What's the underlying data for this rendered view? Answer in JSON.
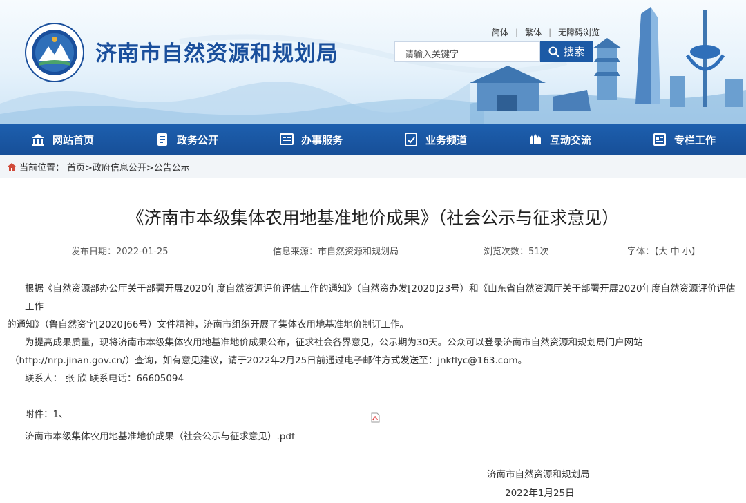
{
  "header": {
    "site_title": "济南市自然资源和规划局",
    "top_links": [
      "简体",
      "繁体",
      "无障碍浏览"
    ],
    "search": {
      "placeholder": "请输入关键字",
      "button_label": "搜索"
    },
    "accent": "#1c5aa6"
  },
  "nav": {
    "items": [
      {
        "label": "网站首页",
        "icon": "home-icon"
      },
      {
        "label": "政务公开",
        "icon": "document-icon"
      },
      {
        "label": "办事服务",
        "icon": "service-icon"
      },
      {
        "label": "业务频道",
        "icon": "channel-icon"
      },
      {
        "label": "互动交流",
        "icon": "hands-icon"
      },
      {
        "label": "专栏工作",
        "icon": "column-icon"
      }
    ]
  },
  "breadcrumb": {
    "prefix": "当前位置：",
    "path": "首页>政府信息公开>公告公示"
  },
  "article": {
    "title": "《济南市本级集体农用地基准地价成果》（社会公示与征求意见）",
    "meta": {
      "publish_date": "发布日期：2022-01-25",
      "source": "信息来源：市自然资源和规划局",
      "views": "浏览次数：51次",
      "font_size": "字体：【大 中 小】"
    },
    "para1_a": "根据《自然资源部办公厅关于部署开展2020年度自然资源评价评估工作的通知》（自然资办发[2020]23号）和《山东省自然资源厅关于部署开展2020年度自然资源评价评估工作",
    "para1_b": "的通知》（鲁自然资字[2020]66号）文件精神，济南市组织开展了集体农用地基准地价制订工作。",
    "para2_a": "为提高成果质量，现将济南市本级集体农用地基准地价成果公布，征求社会各界意见，公示期为30天。公众可以登录济南市自然资源和规划局门户网站",
    "para2_b": "（http://nrp.jinan.gov.cn/）查询，如有意见建议，请于2022年2月25日前通过电子邮件方式发送至：jnkflyc@163.com。",
    "contact": "联系人：  张 欣   联系电话：66605094",
    "attachment_label": "附件：1、",
    "attachment_file": "济南市本级集体农用地基准地价成果（社会公示与征求意见）.pdf",
    "sign_org": "济南市自然资源和规划局",
    "sign_date": "2022年1月25日"
  }
}
